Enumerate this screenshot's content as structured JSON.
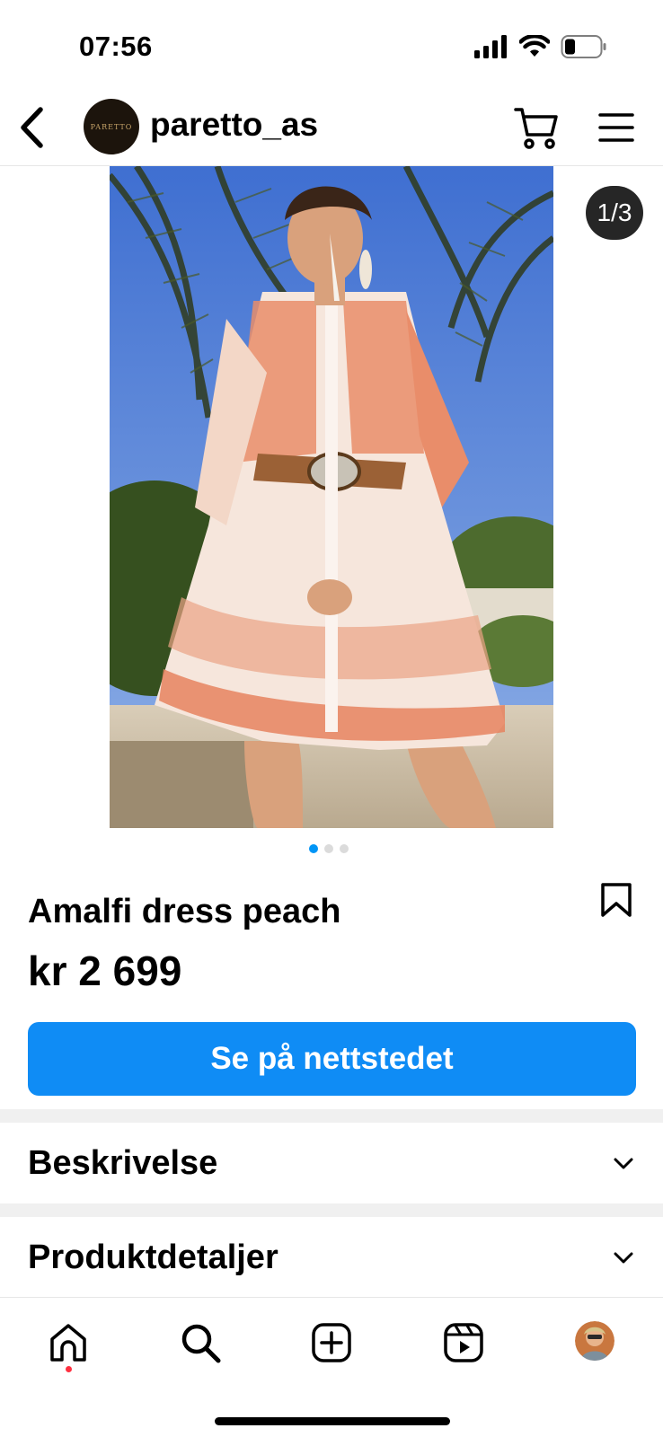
{
  "status_bar": {
    "time": "07:56",
    "icons": [
      "cellular-signal-icon",
      "wifi-icon",
      "battery-icon"
    ]
  },
  "header": {
    "account_name": "paretto_as",
    "avatar_text": "PARETTO",
    "icons": [
      "back-icon",
      "cart-icon",
      "menu-icon"
    ]
  },
  "media": {
    "counter": "1/3",
    "current_index": 1,
    "total": 3
  },
  "product": {
    "title": "Amalfi dress peach",
    "price": "kr 2 699",
    "cta_label": "Se på nettstedet"
  },
  "sections": [
    {
      "label": "Beskrivelse"
    },
    {
      "label": "Produktdetaljer"
    }
  ],
  "tab_bar": {
    "tabs": [
      "home-icon",
      "search-icon",
      "create-icon",
      "reels-icon",
      "profile-avatar"
    ]
  },
  "colors": {
    "accent": "#0f8cf5",
    "dot_active": "#0095f6",
    "notification": "#ff3040"
  }
}
